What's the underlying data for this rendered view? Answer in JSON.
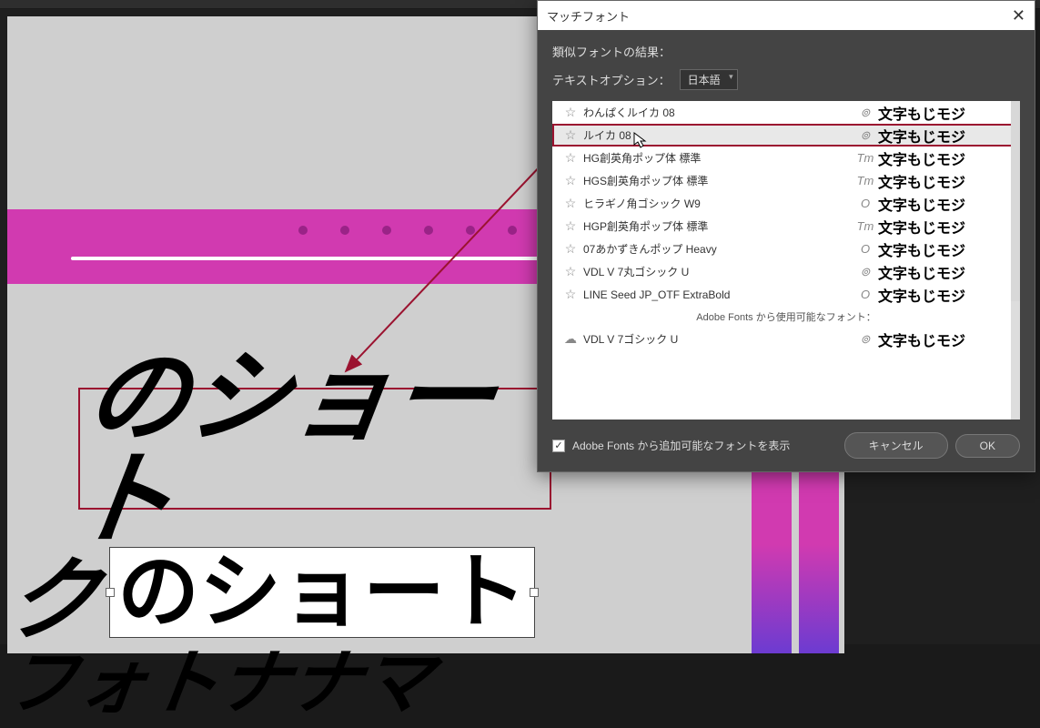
{
  "dialog": {
    "title": "マッチフォント",
    "results_label": "類似フォントの結果：",
    "text_options_label": "テキストオプション：",
    "language_selected": "日本語",
    "adobe_fonts_header": "Adobe Fonts から使用可能なフォント：",
    "checkbox_label": "Adobe Fonts から追加可能なフォントを表示",
    "cancel": "キャンセル",
    "ok": "OK"
  },
  "fonts": [
    {
      "name": "わんぱくルイカ 08",
      "type": "cc",
      "preview": "文字もじモジ",
      "highlighted": false
    },
    {
      "name": "ルイカ 08",
      "type": "cc",
      "preview": "文字もじモジ",
      "highlighted": true
    },
    {
      "name": "HG創英角ポップ体 標準",
      "type": "tt",
      "preview": "文字もじモジ",
      "highlighted": false
    },
    {
      "name": "HGS創英角ポップ体 標準",
      "type": "tt",
      "preview": "文字もじモジ",
      "highlighted": false
    },
    {
      "name": "ヒラギノ角ゴシック W9",
      "type": "o",
      "preview": "文字もじモジ",
      "highlighted": false
    },
    {
      "name": "HGP創英角ポップ体 標準",
      "type": "tt",
      "preview": "文字もじモジ",
      "highlighted": false
    },
    {
      "name": "07あかずきんポップ Heavy",
      "type": "o",
      "preview": "文字もじモジ",
      "highlighted": false
    },
    {
      "name": "VDL V 7丸ゴシック U",
      "type": "cc",
      "preview": "文字もじモジ",
      "highlighted": false
    },
    {
      "name": "LINE Seed JP_OTF ExtraBold",
      "type": "o",
      "preview": "文字もじモジ",
      "highlighted": false
    }
  ],
  "adobe_fonts": [
    {
      "name": "VDL V 7ゴシック U",
      "type": "cc",
      "preview": "文字もじモジ"
    }
  ],
  "canvas": {
    "line1": "のショート",
    "line2_prefix": "ク",
    "line2_selected": "のショート",
    "line3": "フォトナナマ"
  }
}
